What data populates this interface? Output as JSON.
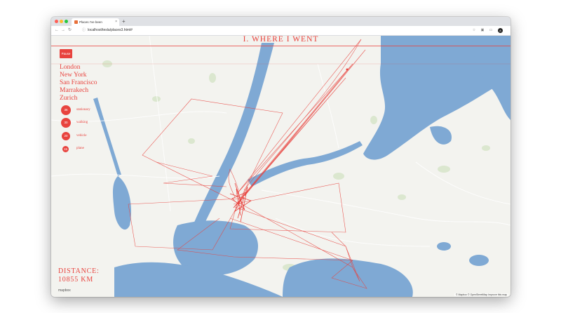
{
  "browser": {
    "tab_title": "Places I've been",
    "tab_close": "×",
    "new_tab": "+",
    "url": "localhost/tesla/places3.html#",
    "nav": {
      "back": "←",
      "forward": "→",
      "reload": "↻"
    },
    "avatar_letter": "A",
    "traffic_colors": [
      "#ff5f57",
      "#febc2e",
      "#28c840"
    ]
  },
  "page": {
    "title": "I. WHERE I WENT",
    "pause_label": "Pause",
    "cities": [
      "London",
      "New York",
      "San Francisco",
      "Marrakech",
      "Zurich"
    ],
    "modes": [
      {
        "count": "36",
        "label": "stationary"
      },
      {
        "count": "30",
        "label": "walking"
      },
      {
        "count": "20",
        "label": "vehicle"
      },
      {
        "count": "15",
        "label": "plane"
      }
    ],
    "distance_label": "DISTANCE:",
    "distance_value": "10855 KM",
    "map_logo": "mapbox",
    "attribution": "© Mapbox © OpenStreetMap Improve this map",
    "accent_color": "#e8433e",
    "water_color": "#7fa9d4"
  }
}
